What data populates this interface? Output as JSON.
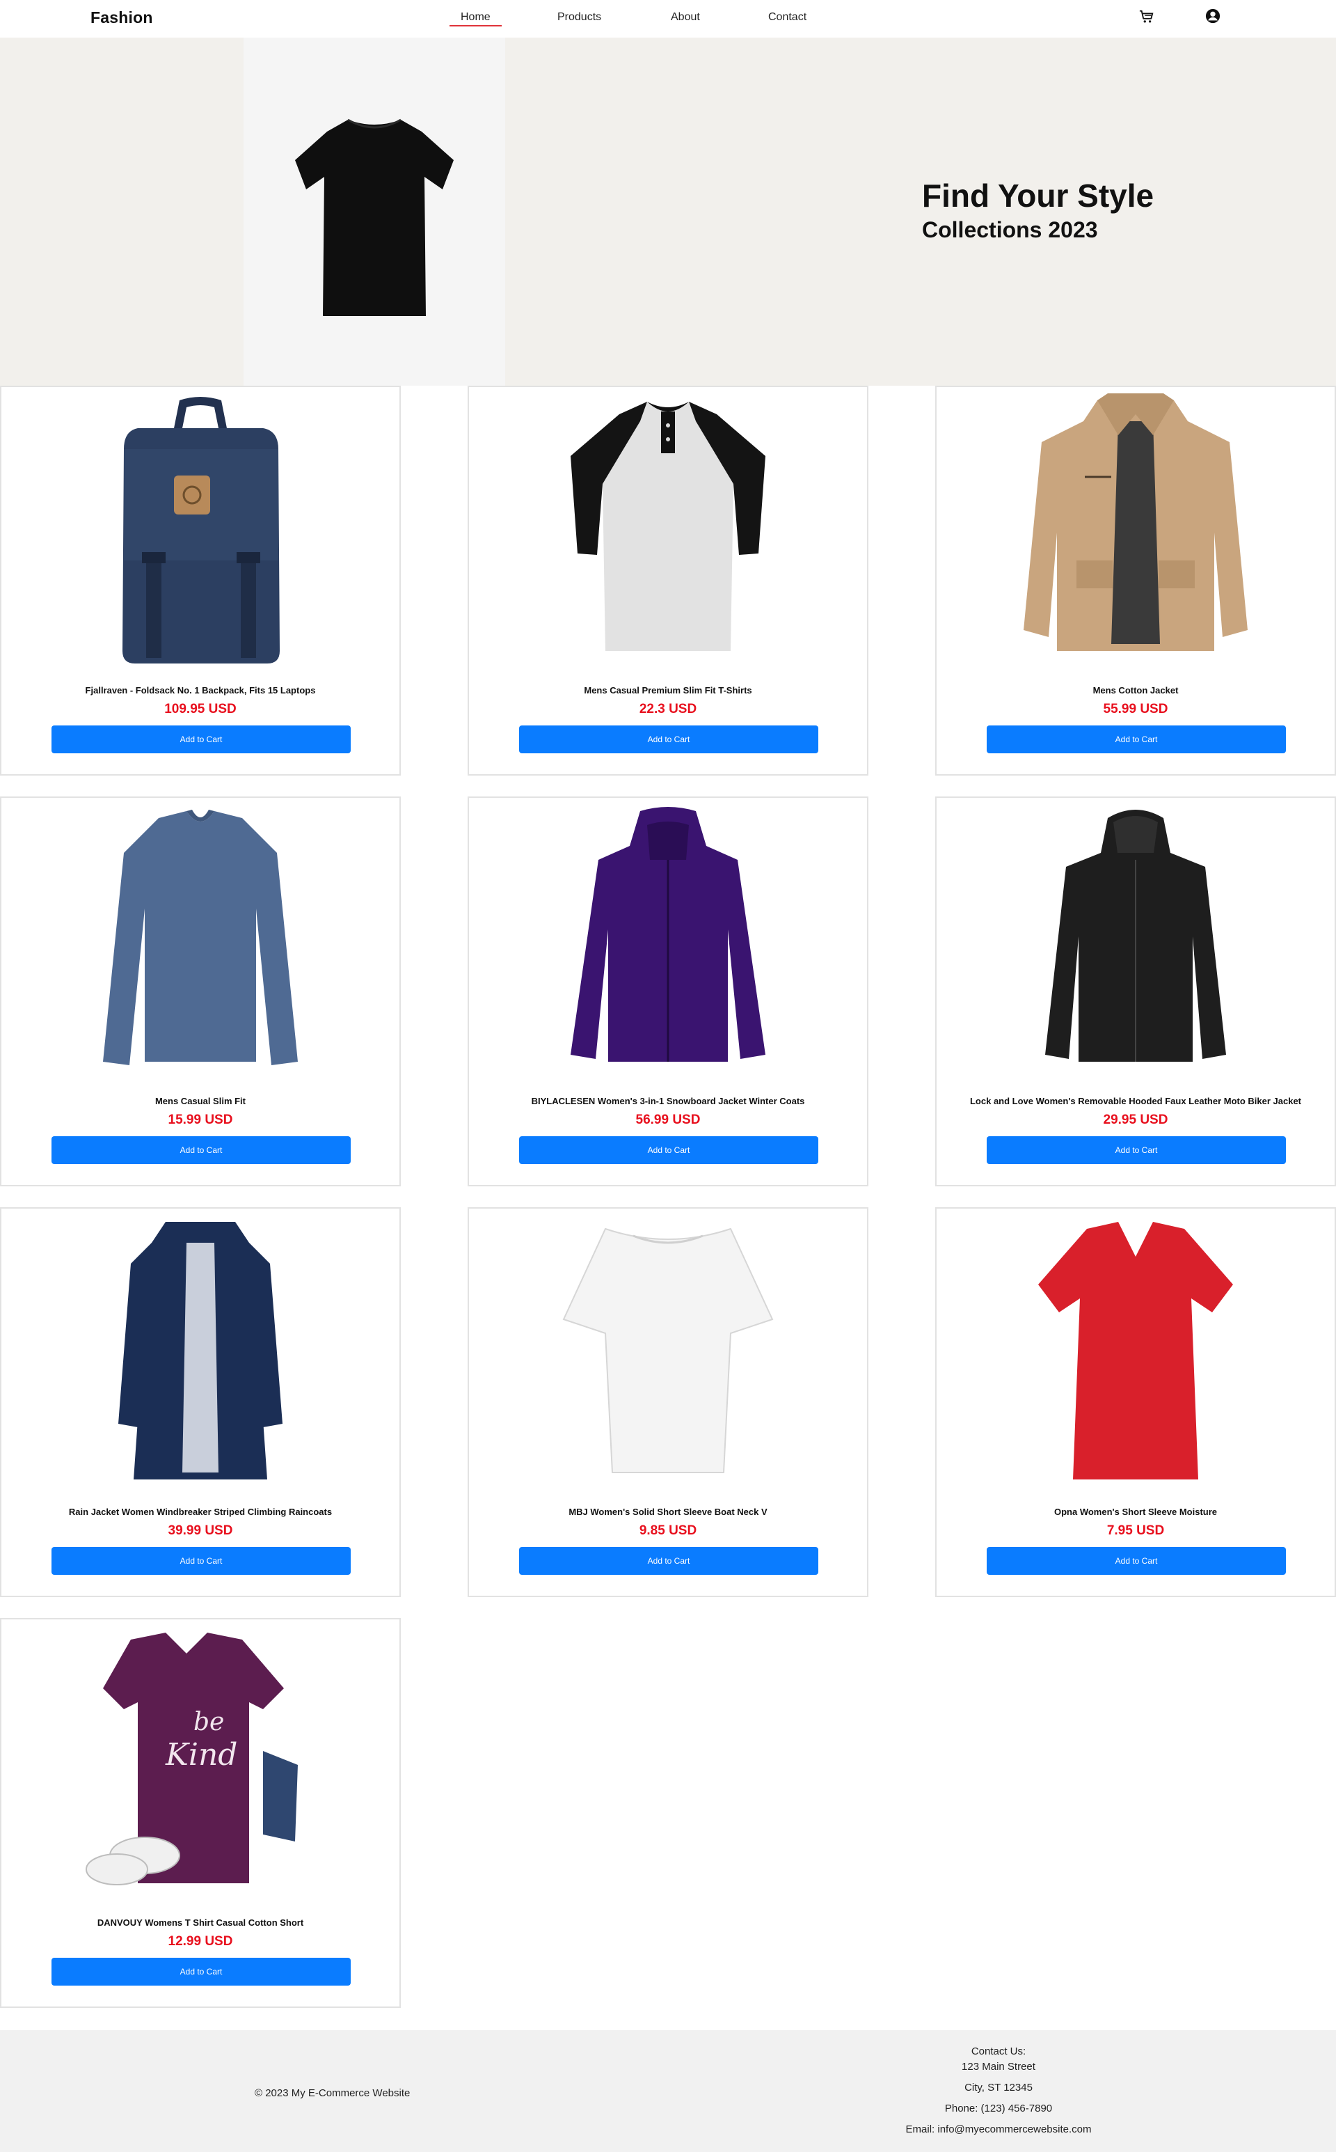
{
  "header": {
    "logo": "Fashion",
    "nav": [
      {
        "label": "Home",
        "active": true
      },
      {
        "label": "Products",
        "active": false
      },
      {
        "label": "About",
        "active": false
      },
      {
        "label": "Contact",
        "active": false
      }
    ],
    "cart_icon": "cart-icon",
    "account_icon": "user-circle-icon"
  },
  "hero": {
    "title": "Find Your Style",
    "subtitle": "Collections 2023",
    "image": "black-tshirt"
  },
  "products": [
    {
      "title": "Fjallraven - Foldsack No. 1 Backpack, Fits 15 Laptops",
      "price": "109.95 USD",
      "button": "Add to Cart",
      "image": "navy-backpack"
    },
    {
      "title": "Mens Casual Premium Slim Fit T-Shirts",
      "price": "22.3 USD",
      "button": "Add to Cart",
      "image": "raglan-henley-shirt"
    },
    {
      "title": "Mens Cotton Jacket",
      "price": "55.99 USD",
      "button": "Add to Cart",
      "image": "khaki-cotton-jacket"
    },
    {
      "title": "Mens Casual Slim Fit",
      "price": "15.99 USD",
      "button": "Add to Cart",
      "image": "blue-longsleeve-shirt"
    },
    {
      "title": "BIYLACLESEN Women's 3-in-1 Snowboard Jacket Winter Coats",
      "price": "56.99 USD",
      "button": "Add to Cart",
      "image": "purple-snowboard-jacket"
    },
    {
      "title": "Lock and Love Women's Removable Hooded Faux Leather Moto Biker Jacket",
      "price": "29.95 USD",
      "button": "Add to Cart",
      "image": "black-leather-jacket"
    },
    {
      "title": "Rain Jacket Women Windbreaker Striped Climbing Raincoats",
      "price": "39.99 USD",
      "button": "Add to Cart",
      "image": "navy-raincoat"
    },
    {
      "title": "MBJ Women's Solid Short Sleeve Boat Neck V",
      "price": "9.85 USD",
      "button": "Add to Cart",
      "image": "white-boatneck-top"
    },
    {
      "title": "Opna Women's Short Sleeve Moisture",
      "price": "7.95 USD",
      "button": "Add to Cart",
      "image": "red-vneck-tshirt"
    },
    {
      "title": "DANVOUY Womens T Shirt Casual Cotton Short",
      "price": "12.99 USD",
      "button": "Add to Cart",
      "image": "purple-be-kind-tshirt"
    }
  ],
  "footer": {
    "copyright": "© 2023 My E-Commerce Website",
    "contact_heading": "Contact Us:",
    "address_line1": "123 Main Street",
    "address_line2": "City, ST 12345",
    "phone": "Phone: (123) 456-7890",
    "email": "Email: info@myecommercewebsite.com"
  },
  "colors": {
    "accent_button": "#0a7cff",
    "price": "#e8101e",
    "nav_active_underline": "#e0333a",
    "hero_bg": "#f2f0ec",
    "footer_bg": "#f1f1f1"
  }
}
